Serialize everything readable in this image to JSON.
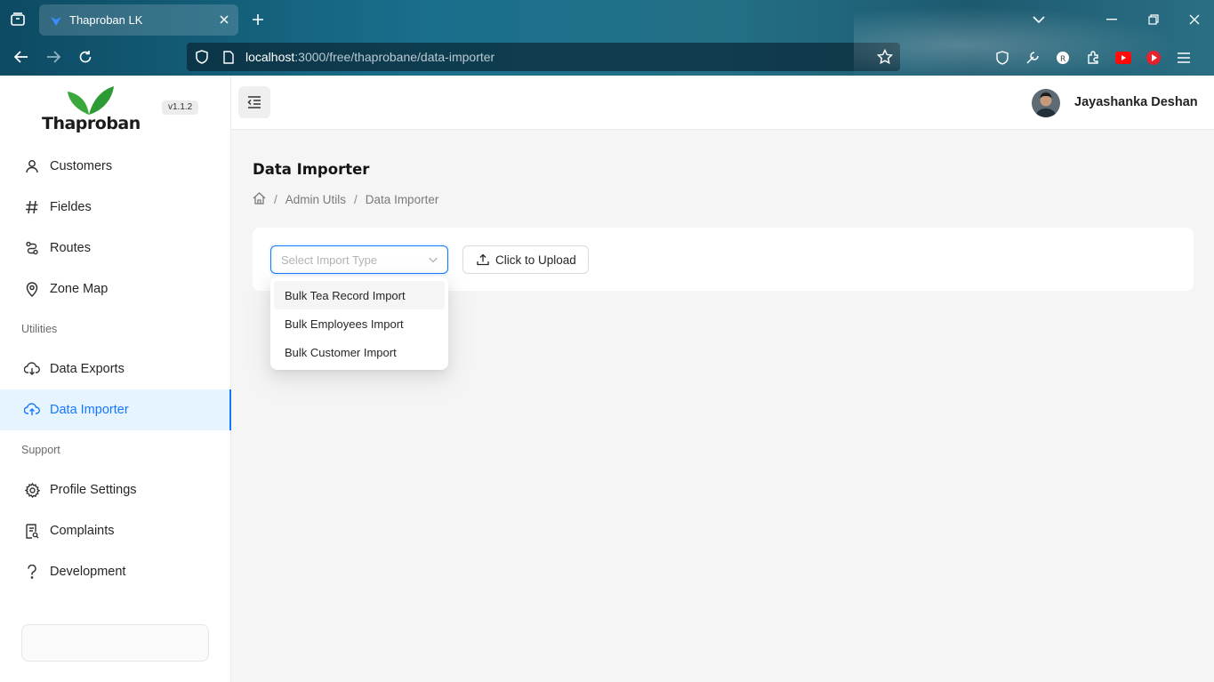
{
  "browser": {
    "tab_title": "Thaproban LK",
    "url_host": "localhost",
    "url_path": ":3000/free/thaprobane/data-importer"
  },
  "sidebar": {
    "version": "v1.1.2",
    "logo_text": "Thaproban",
    "items_main": [
      {
        "label": "Customers",
        "icon": "user-icon"
      },
      {
        "label": "Fieldes",
        "icon": "hash-icon"
      },
      {
        "label": "Routes",
        "icon": "route-icon"
      },
      {
        "label": "Zone Map",
        "icon": "map-pin-icon"
      }
    ],
    "section_utilities": "Utilities",
    "items_utilities": [
      {
        "label": "Data Exports",
        "icon": "cloud-download-icon"
      },
      {
        "label": "Data Importer",
        "icon": "cloud-upload-icon",
        "active": true
      }
    ],
    "section_support": "Support",
    "items_support": [
      {
        "label": "Profile Settings",
        "icon": "gear-icon"
      },
      {
        "label": "Complaints",
        "icon": "report-icon"
      },
      {
        "label": "Development",
        "icon": "question-icon"
      }
    ]
  },
  "header": {
    "user_name": "Jayashanka Deshan"
  },
  "main": {
    "title": "Data Importer",
    "breadcrumb": [
      "Admin Utils",
      "Data Importer"
    ],
    "select_placeholder": "Select Import Type",
    "upload_label": "Click to Upload",
    "dropdown_options": [
      "Bulk Tea Record Import",
      "Bulk Employees Import",
      "Bulk Customer Import"
    ]
  },
  "colors": {
    "accent": "#1677ff",
    "active_bg": "#e6f4ff",
    "logo_green": "#3aa83a"
  }
}
